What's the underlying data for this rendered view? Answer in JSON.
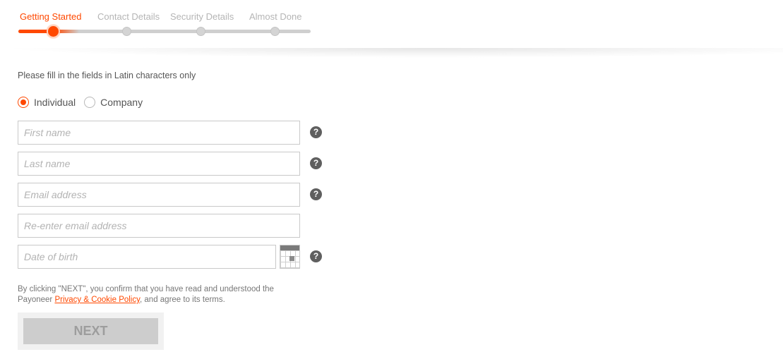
{
  "stepper": {
    "steps": [
      {
        "label": "Getting Started",
        "active": true
      },
      {
        "label": "Contact Details",
        "active": false
      },
      {
        "label": "Security Details",
        "active": false
      },
      {
        "label": "Almost Done",
        "active": false
      }
    ],
    "progress_fraction": 0.125,
    "accent_color": "#ff4800"
  },
  "form": {
    "instructions": "Please fill in the fields in Latin characters only",
    "account_type": {
      "options": [
        {
          "label": "Individual",
          "selected": true
        },
        {
          "label": "Company",
          "selected": false
        }
      ]
    },
    "fields": {
      "first_name": {
        "placeholder": "First name",
        "value": "",
        "has_help": true
      },
      "last_name": {
        "placeholder": "Last name",
        "value": "",
        "has_help": true
      },
      "email": {
        "placeholder": "Email address",
        "value": "",
        "has_help": true
      },
      "email_confirm": {
        "placeholder": "Re-enter email address",
        "value": "",
        "has_help": false
      },
      "dob": {
        "placeholder": "Date of birth",
        "value": "",
        "has_help": true
      }
    },
    "help_icon": "?",
    "calendar_icon": "calendar-icon"
  },
  "consent": {
    "prefix": "By clicking \"NEXT\", you confirm that you have read and understood the Payoneer ",
    "link": "Privacy & Cookie Policy",
    "suffix": ", and agree to its terms."
  },
  "next_button": {
    "label": "NEXT",
    "enabled": false
  }
}
